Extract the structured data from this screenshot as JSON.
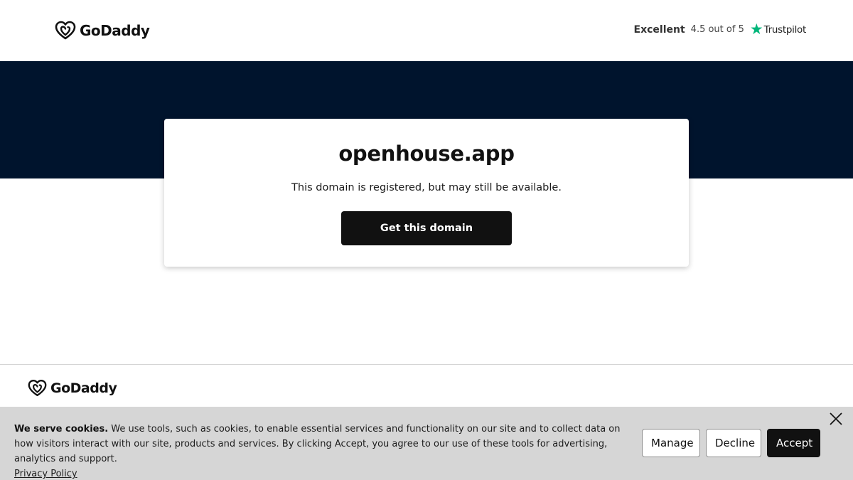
{
  "header": {
    "brand": "GoDaddy",
    "rating": {
      "label": "Excellent",
      "score": "4.5 out of 5",
      "provider": "Trustpilot"
    }
  },
  "card": {
    "domain": "openhouse.app",
    "message": "This domain is registered, but may still be available.",
    "cta_label": "Get this domain"
  },
  "footer": {
    "brand": "GoDaddy"
  },
  "cookie_banner": {
    "heading": "We serve cookies.",
    "body": " We use tools, such as cookies, to enable essential services and functionality on our site and to collect data on how visitors interact with our site, products and services. By clicking Accept, you agree to our use of these tools for advertising, analytics and support.",
    "privacy_link": "Privacy Policy",
    "buttons": {
      "manage": "Manage",
      "decline": "Decline",
      "accept": "Accept"
    }
  },
  "colors": {
    "hero_bg": "#00142d",
    "trustpilot_star": "#00b67a",
    "cta_bg": "#111111",
    "cookie_bg": "#d6d6d6"
  },
  "icons": {
    "brand_logo": "godaddy-heart-logo-icon",
    "rating_star": "trustpilot-star-icon",
    "close": "close-icon"
  }
}
